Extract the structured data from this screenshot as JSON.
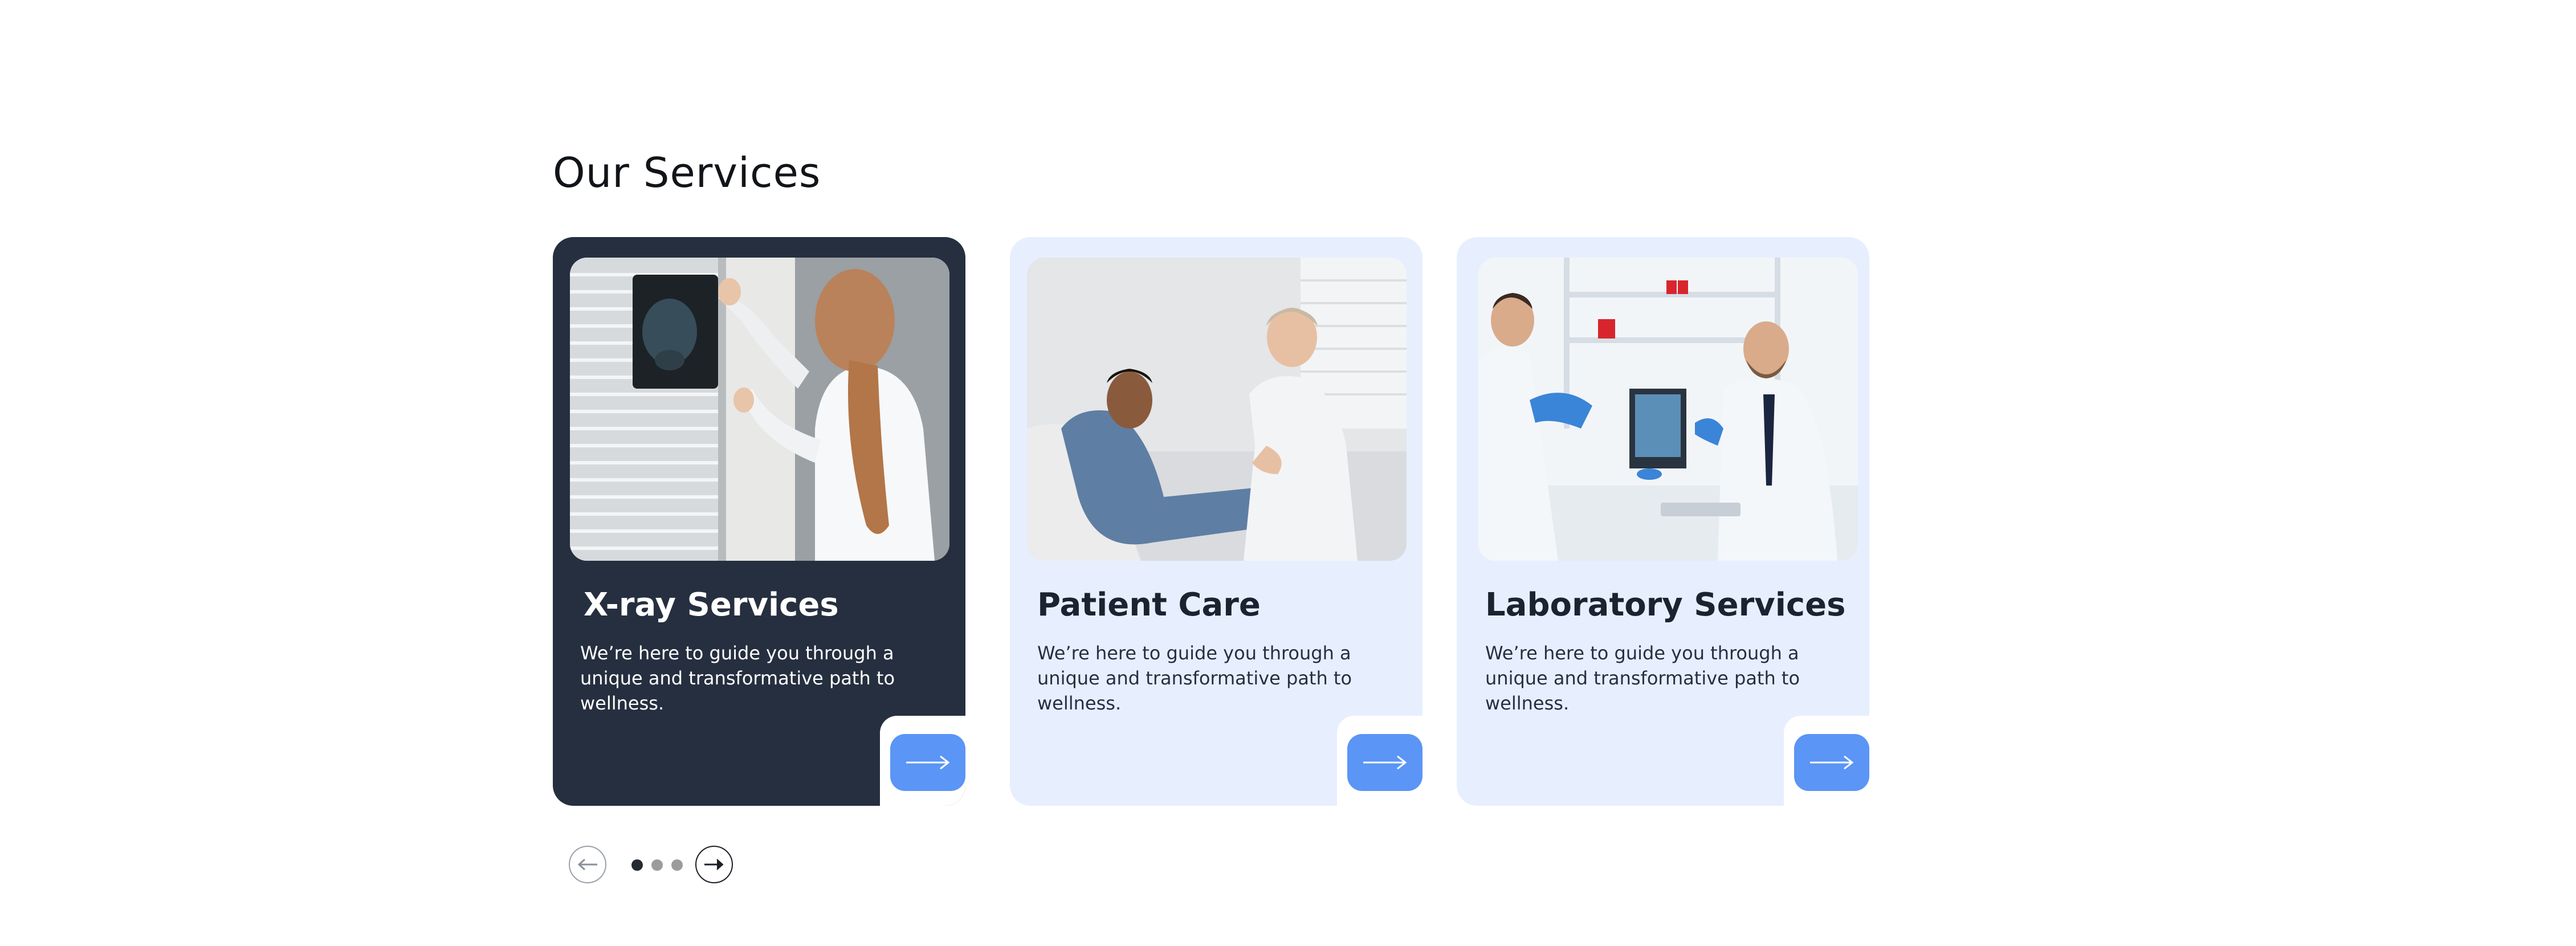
{
  "section": {
    "title": "Our Services"
  },
  "cards": [
    {
      "title": "X-ray Services",
      "description": "We’re here to guide you through a unique and transformative path to wellness.",
      "image_icon": "doctor-examining-xray-image",
      "theme": "dark"
    },
    {
      "title": "Patient Care",
      "description": "We’re here to guide you through a unique and transformative path to wellness.",
      "image_icon": "doctor-comforting-patient-image",
      "theme": "light"
    },
    {
      "title": "Laboratory Services",
      "description": "We’re here to guide you through a unique and transformative path to wellness.",
      "image_icon": "lab-scientists-image",
      "theme": "light"
    }
  ],
  "pager": {
    "total_pages": 3,
    "active_page": 1
  },
  "colors": {
    "dark_card": "#262f3f",
    "light_card": "#e7efff",
    "accent_button": "#5b95f5",
    "active_dot": "#262a31",
    "inactive_dot": "#9c9c9c"
  }
}
